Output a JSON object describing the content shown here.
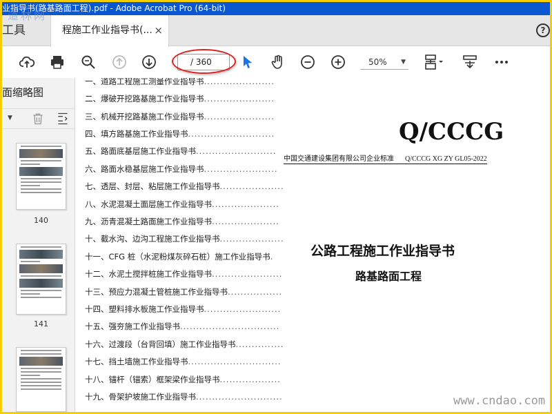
{
  "window": {
    "title": "业指导书(路基路面工程).pdf - Adobe Acrobat Pro (64-bit)"
  },
  "watermark_top": "道林网",
  "tabs": {
    "tools_label": "工具",
    "doc_tab_label": "程施工作业指导书(...",
    "close_glyph": "×",
    "help_glyph": "?"
  },
  "toolbar": {
    "page_indicator": "/ 360",
    "zoom_value": "50%",
    "zoom_caret": "▼",
    "icons": [
      "upload-icon",
      "print-icon",
      "search-icon",
      "page-up-icon",
      "page-down-icon",
      "select-cursor-icon",
      "hand-icon",
      "zoom-out-icon",
      "zoom-in-icon",
      "page-fit-icon",
      "scroll-mode-icon",
      "more-icon"
    ]
  },
  "left_panel": {
    "title": "面缩略图",
    "thumbnails": [
      {
        "label": "140"
      },
      {
        "label": "141"
      },
      {
        "label": ""
      }
    ]
  },
  "toc": {
    "items": [
      {
        "text": "一、道路工程施工测量作业指导书",
        "dots": "......................"
      },
      {
        "text": "二、爆破开挖路基施工作业指导书",
        "dots": "......................"
      },
      {
        "text": "三、机械开挖路基施工作业指导书",
        "dots": "......................"
      },
      {
        "text": "四、填方路基施工作业指导书",
        "dots": "..........................."
      },
      {
        "text": "五、路面底基层施工作业指导书",
        "dots": "........................."
      },
      {
        "text": "六、路面水稳基层施工作业指导书",
        "dots": "......................."
      },
      {
        "text": "七、透层、封层、粘层施工作业指导书",
        "dots": "...................."
      },
      {
        "text": "八、水泥混凝土面层施工作业指导书",
        "dots": "....................."
      },
      {
        "text": "九、沥青混凝土路面施工作业指导书",
        "dots": "....................."
      },
      {
        "text": "十、截水沟、边沟工程施工作业指导书",
        "dots": "...................."
      },
      {
        "text": "十一、CFG 桩（水泥粉煤灰碎石桩）施工作业指导书",
        "dots": "."
      },
      {
        "text": "十二、水泥土搅拌桩施工作业指导书",
        "dots": "......................"
      },
      {
        "text": "十三、预应力混凝土管桩施工作业指导书",
        "dots": "................."
      },
      {
        "text": "十四、塑料排水板施工作业指导书",
        "dots": "........................"
      },
      {
        "text": "十五、强夯施工作业指导书",
        "dots": "..............................."
      },
      {
        "text": "十六、过渡段（台背回填）施工作业指导书",
        "dots": "..............."
      },
      {
        "text": "十七、挡土墙施工作业指导书",
        "dots": "............................."
      },
      {
        "text": "十八、锚杆（锚索）框架梁作业指导书",
        "dots": "..................."
      },
      {
        "text": "十九、骨架护坡施工作业指导书",
        "dots": "..........................."
      }
    ]
  },
  "document": {
    "logo_text": "Q/CCCG",
    "standard_org": "中国交通建设集团有限公司企业标准",
    "standard_code": "Q/CCCG XG ZY GL05-2022",
    "main_title": "公路工程施工作业指导书",
    "sub_title": "路基路面工程"
  },
  "watermark_bottom": "www.cndao.com"
}
